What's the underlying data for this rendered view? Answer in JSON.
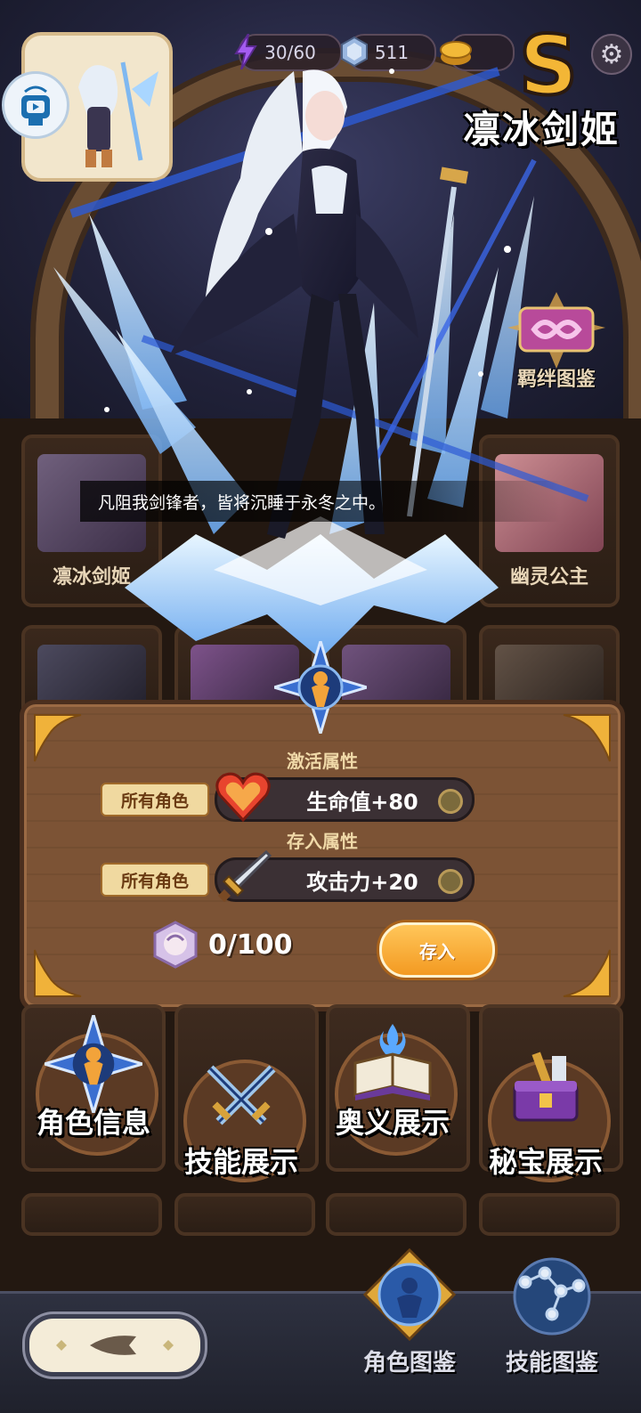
{
  "hud": {
    "stamina": "30/60",
    "gems": "511"
  },
  "hero": {
    "rank": "S",
    "name": "凛冰剑姬",
    "quote": "凡阻我剑锋者，皆将沉睡于永冬之中。"
  },
  "side": {
    "bond_label": "羁绊图鉴"
  },
  "grid": {
    "cards": [
      {
        "name": "凛冰剑姬"
      },
      {
        "name": "幽灵公主"
      }
    ]
  },
  "panel": {
    "activate_title": "激活属性",
    "store_title": "存入属性",
    "rows": [
      {
        "tag": "所有角色",
        "stat": "生命值+80",
        "icon": "heart-icon"
      },
      {
        "tag": "所有角色",
        "stat": "攻击力+20",
        "icon": "sword-icon"
      }
    ],
    "progress": "0/100",
    "deposit_label": "存入"
  },
  "actions": [
    {
      "label": "角色信息",
      "icon": "character-emblem-icon"
    },
    {
      "label": "技能展示",
      "icon": "crossed-swords-icon"
    },
    {
      "label": "奥义展示",
      "icon": "spellbook-icon"
    },
    {
      "label": "秘宝展示",
      "icon": "treasure-chest-icon"
    }
  ],
  "nav": {
    "tabs": [
      {
        "label": "角色图鉴",
        "icon": "character-codex-icon",
        "active": true
      },
      {
        "label": "技能图鉴",
        "icon": "constellation-icon",
        "active": false
      }
    ]
  },
  "colors": {
    "accent": "#f39a22",
    "panel": "#7c5335",
    "ice": "#9fd3ff"
  }
}
